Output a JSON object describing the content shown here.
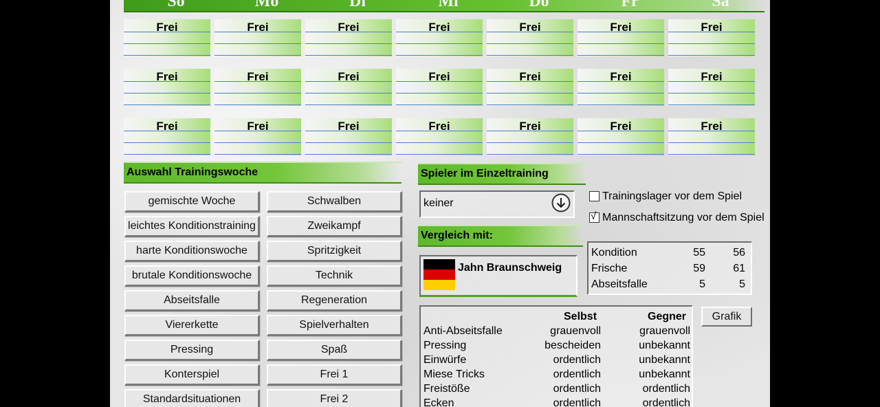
{
  "days": [
    "So",
    "Mo",
    "Di",
    "Mi",
    "Do",
    "Fr",
    "Sa"
  ],
  "schedule": [
    [
      "Frei",
      "Frei",
      "Frei",
      "Frei",
      "Frei",
      "Frei",
      "Frei"
    ],
    [
      "Frei",
      "Frei",
      "Frei",
      "Frei",
      "Frei",
      "Frei",
      "Frei"
    ],
    [
      "Frei",
      "Frei",
      "Frei",
      "Frei",
      "Frei",
      "Frei",
      "Frei"
    ]
  ],
  "training_week": {
    "title": "Auswahl Trainingswoche",
    "left": [
      "gemischte Woche",
      "leichtes Konditionstraining",
      "harte Konditionswoche",
      "brutale Konditionswoche",
      "Abseitsfalle",
      "Viererkette",
      "Pressing",
      "Konterspiel",
      "Standardsituationen"
    ],
    "right": [
      "Schwalben",
      "Zweikampf",
      "Spritzigkeit",
      "Technik",
      "Regeneration",
      "Spielverhalten",
      "Spaß",
      "Frei 1",
      "Frei 2"
    ]
  },
  "individual": {
    "title": "Spieler im Einzeltraining",
    "selected": "keiner",
    "dropdown_icon": "circle-arrow-down-icon"
  },
  "options": {
    "camp_label": "Trainingslager vor dem Spiel",
    "camp_checked": false,
    "meeting_label": "Mannschaftsitzung vor dem Spiel",
    "meeting_checked": true,
    "check_mark": "√"
  },
  "compare": {
    "title": "Vergleich mit:",
    "team": "Jahn Braunschweig",
    "flag_colors": [
      "#000000",
      "#dd0000",
      "#ffce00"
    ]
  },
  "stats": [
    {
      "label": "Kondition",
      "own": "55",
      "opp": "56"
    },
    {
      "label": "Frische",
      "own": "59",
      "opp": "61"
    },
    {
      "label": "Abseitsfalle",
      "own": "5",
      "opp": "5"
    }
  ],
  "grafik_label": "Grafik",
  "skills": {
    "col_self": "Selbst",
    "col_opp": "Gegner",
    "rows": [
      {
        "name": "Anti-Abseitsfalle",
        "self": "grauenvoll",
        "opp": "grauenvoll"
      },
      {
        "name": "Pressing",
        "self": "bescheiden",
        "opp": "unbekannt"
      },
      {
        "name": "Einwürfe",
        "self": "ordentlich",
        "opp": "unbekannt"
      },
      {
        "name": "Miese Tricks",
        "self": "ordentlich",
        "opp": "unbekannt"
      },
      {
        "name": "Freistöße",
        "self": "ordentlich",
        "opp": "ordentlich"
      },
      {
        "name": "Ecken",
        "self": "ordentlich",
        "opp": "ordentlich"
      }
    ]
  }
}
